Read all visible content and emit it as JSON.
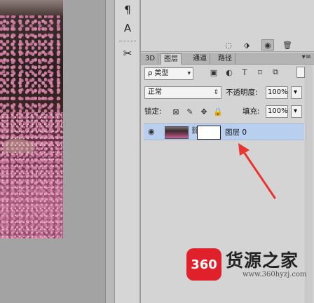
{
  "panel": {
    "tabs": [
      "3D",
      "图层",
      "通道",
      "路径"
    ],
    "active_tab": "图层",
    "filter_kind": "ρ 类型",
    "blend_mode": "正常",
    "opacity_label": "不透明度:",
    "opacity_value": "100%",
    "lock_label": "锁定:",
    "fill_label": "填充:",
    "fill_value": "100%",
    "layer_name": "图层 0",
    "tab_menu_icon": "panel-menu-icon"
  },
  "toolstrip": {
    "icons": [
      "paragraph-icon",
      "character-style-icon",
      "tools-preset-icon"
    ]
  },
  "watermark": {
    "badge": "360",
    "title": "货源之家",
    "url": "www.360hyzj.com"
  },
  "colors": {
    "selected_layer": "#b9cff0",
    "annotation_arrow": "#e8352f",
    "watermark_badge": "#e0202a"
  }
}
